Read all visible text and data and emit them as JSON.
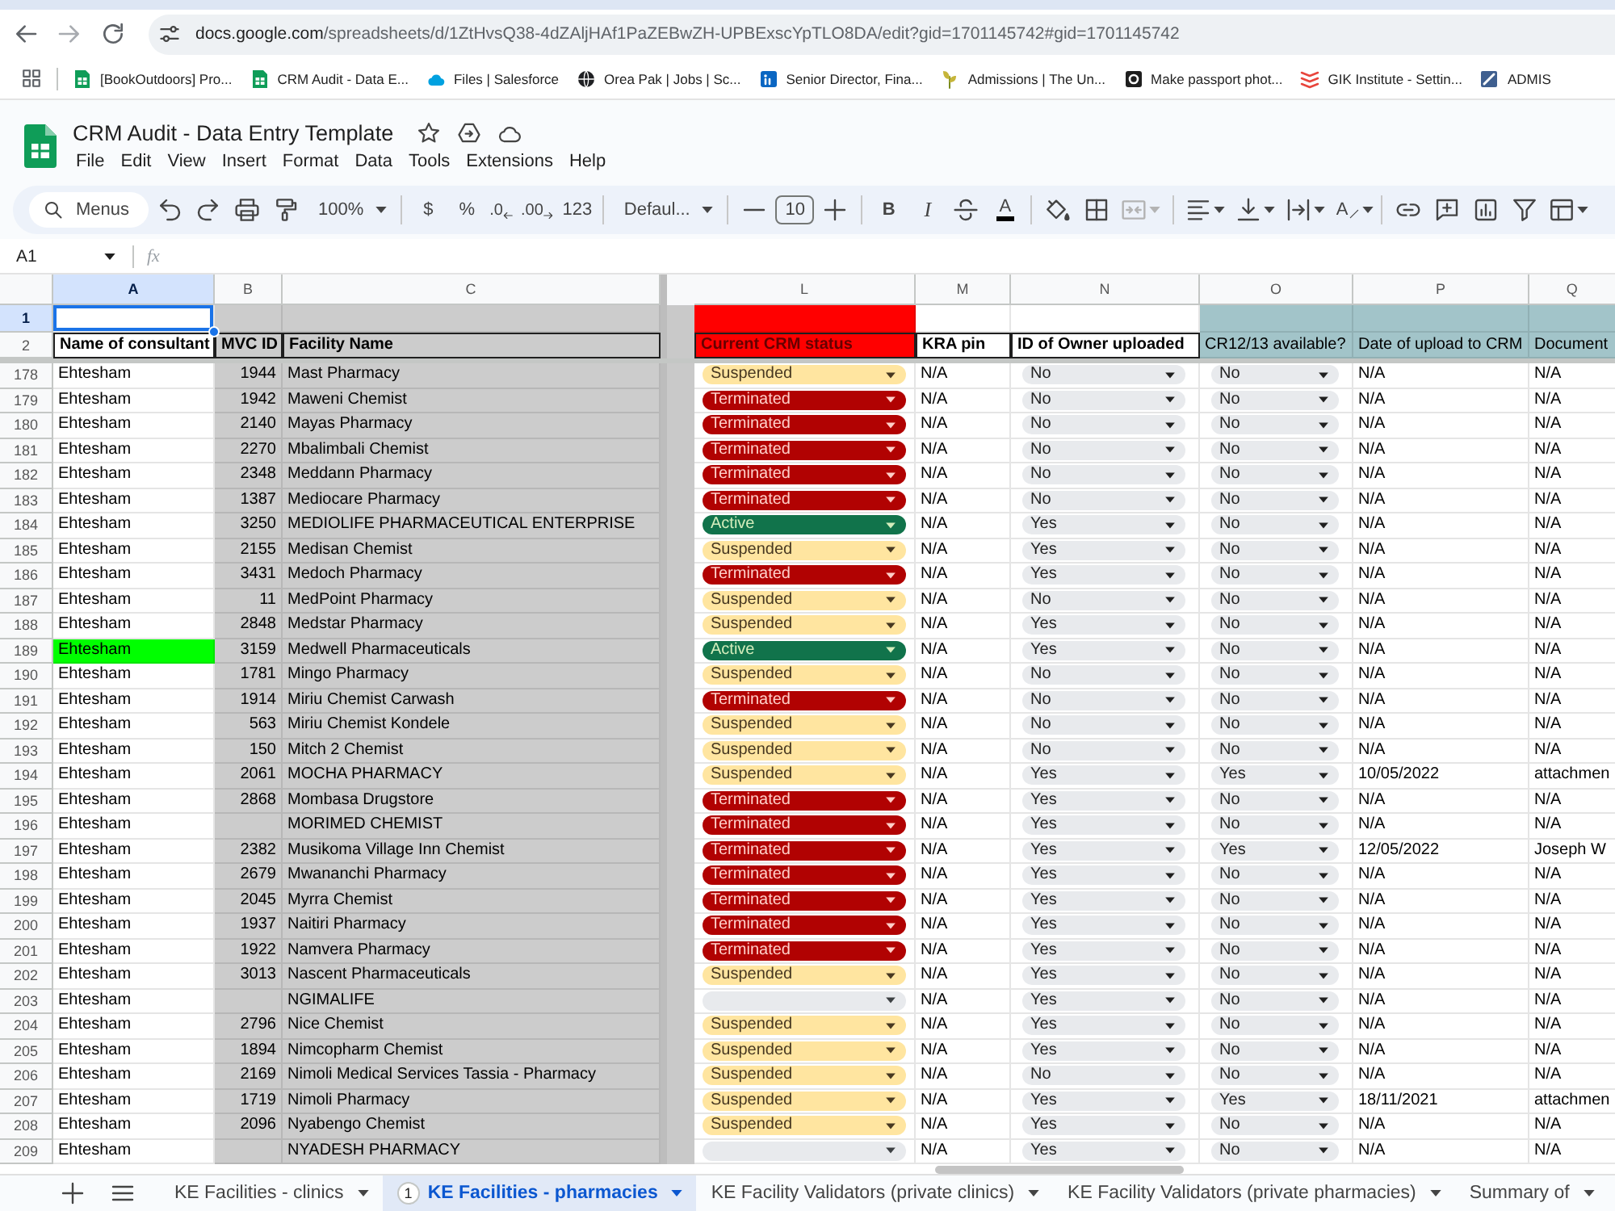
{
  "browser": {
    "address": {
      "host": "docs.google.com",
      "path": "/spreadsheets/d/1ZtHvsQ38-4dZAljHAf1PaZEBwZH-UPBExscYpTLO8DA/edit?gid=1701145742#gid=1701145742"
    },
    "bookmarks": [
      {
        "label": "[BookOutdoors] Pro...",
        "kind": "sheet"
      },
      {
        "label": "CRM Audit - Data E...",
        "kind": "sheet"
      },
      {
        "label": "Files | Salesforce",
        "kind": "cloud"
      },
      {
        "label": "Orea Pak | Jobs | Sc...",
        "kind": "globe"
      },
      {
        "label": "Senior Director, Fina...",
        "kind": "tile"
      },
      {
        "label": "Admissions | The Un...",
        "kind": "plant"
      },
      {
        "label": "Make passport phot...",
        "kind": "ring"
      },
      {
        "label": "GIK Institute - Settin...",
        "kind": "chevrons"
      },
      {
        "label": "ADMIS",
        "kind": "stripe"
      }
    ]
  },
  "document": {
    "title": "CRM Audit - Data Entry Template",
    "menus": [
      "File",
      "Edit",
      "View",
      "Insert",
      "Format",
      "Data",
      "Tools",
      "Extensions",
      "Help"
    ]
  },
  "toolbar": [
    [
      {
        "kind": "search",
        "label": "Menus",
        "disabled": false
      },
      {
        "kind": "undo",
        "disabled": false
      },
      {
        "kind": "redo",
        "disabled": false
      },
      {
        "kind": "print",
        "disabled": false
      },
      {
        "kind": "paint-format",
        "disabled": false
      },
      {
        "kind": "zoom",
        "label": "100%",
        "disabled": false
      }
    ],
    [
      {
        "kind": "currency",
        "label": "$",
        "disabled": false
      },
      {
        "kind": "percent",
        "label": "%",
        "disabled": false
      },
      {
        "kind": "decimal-decrease",
        "label": ".0",
        "disabled": false
      },
      {
        "kind": "decimal-increase",
        "label": ".00",
        "disabled": false
      },
      {
        "kind": "number-format",
        "label": "123",
        "disabled": false
      }
    ],
    [
      {
        "kind": "font",
        "label": "Defaul...",
        "disabled": false
      }
    ],
    [
      {
        "kind": "decrease",
        "disabled": false
      },
      {
        "kind": "font-size",
        "value": "10",
        "disabled": false
      },
      {
        "kind": "increase",
        "disabled": false
      }
    ],
    [
      {
        "kind": "bold",
        "label": "B",
        "disabled": false
      },
      {
        "kind": "italic",
        "label": "I",
        "disabled": false
      },
      {
        "kind": "strikethrough",
        "disabled": false
      },
      {
        "kind": "text-color",
        "label": "A",
        "disabled": false
      }
    ],
    [
      {
        "kind": "fill-color",
        "disabled": false
      },
      {
        "kind": "borders",
        "disabled": false
      },
      {
        "kind": "merge",
        "disabled": true
      }
    ],
    [
      {
        "kind": "align",
        "disabled": false
      },
      {
        "kind": "valign",
        "disabled": false
      },
      {
        "kind": "wrap",
        "disabled": false
      },
      {
        "kind": "rotate",
        "label": "A",
        "disabled": false
      }
    ],
    [
      {
        "kind": "link",
        "disabled": false
      },
      {
        "kind": "comment",
        "disabled": false
      },
      {
        "kind": "chart",
        "disabled": false
      },
      {
        "kind": "filter",
        "disabled": false
      },
      {
        "kind": "table",
        "disabled": false
      }
    ]
  ],
  "formula_bar": {
    "name_box": "A1",
    "function_label": "fx"
  },
  "sheet": {
    "columns": [
      {
        "label": "A",
        "selected": true,
        "freeze_after": false
      },
      {
        "label": "B",
        "selected": false,
        "color": "#cccccc",
        "freeze_after": false
      },
      {
        "label": "C",
        "selected": false,
        "color": "#cccccc",
        "freeze_after": true
      },
      {
        "label": "L",
        "selected": false,
        "freeze_after": false
      },
      {
        "label": "M",
        "selected": false,
        "freeze_after": false
      },
      {
        "label": "N",
        "selected": false,
        "freeze_after": false
      },
      {
        "label": "O",
        "selected": false,
        "freeze_after": false
      },
      {
        "label": "P",
        "selected": false,
        "freeze_after": false
      },
      {
        "label": "Q",
        "selected": false,
        "freeze_after": false
      }
    ],
    "header_rows": [
      {
        "row": "1",
        "selected": true,
        "cells": [
          {
            "color": "#ffffff",
            "selected": true
          },
          {
            "color": "#cccccc",
            "selected": false
          },
          {
            "color": "#cccccc",
            "selected": false
          },
          {
            "color": "#ff0000",
            "selected": false
          },
          {
            "color": "#ffffff",
            "selected": false
          },
          {
            "color": "#ffffff",
            "selected": false
          },
          {
            "color": "#a2c4c9",
            "selected": false
          },
          {
            "color": "#a2c4c9",
            "selected": false
          },
          {
            "color": "#a2c4c9",
            "selected": false
          }
        ]
      },
      {
        "row": "2",
        "selected": false,
        "cells": [
          {
            "text": "Name of consultant",
            "color": "#ffffff",
            "bold": true,
            "bordered": true,
            "selected": false
          },
          {
            "text": "MVC ID",
            "color": "#cccccc",
            "bold": true,
            "bordered": true,
            "selected": false
          },
          {
            "text": "Facility Name",
            "color": "#cccccc",
            "bold": true,
            "bordered": true,
            "selected": false
          },
          {
            "text": "Current CRM status",
            "color": "#ff0000",
            "text_style": {
              "color": "#660000"
            },
            "bold": true,
            "bordered": true,
            "selected": false
          },
          {
            "text": "KRA pin",
            "color": "#ffffff",
            "bold": true,
            "bordered": true,
            "selected": false
          },
          {
            "text": "ID of Owner uploaded",
            "color": "#ffffff",
            "bold": true,
            "bordered": true,
            "selected": false
          },
          {
            "text": "CR12/13 available?",
            "color": "#a2c4c9",
            "bold": false,
            "bordered": false,
            "selected": false
          },
          {
            "text": "Date of upload to CRM",
            "color": "#a2c4c9",
            "bold": false,
            "bordered": false,
            "selected": false
          },
          {
            "text": "Document",
            "color": "#a2c4c9",
            "bold": false,
            "bordered": false,
            "selected": false
          }
        ]
      }
    ],
    "rows": [
      {
        "row": "178",
        "consultant": "Ehtesham",
        "highlighted": false,
        "mvc_id": "1944",
        "facility": "Mast Pharmacy",
        "crm_status": {
          "kind": "suspended",
          "label": "Suspended"
        },
        "kra_pin": "N/A",
        "owner_id_uploaded": "No",
        "cr12_13_available": "No",
        "upload_date": "N/A",
        "document": "N/A"
      },
      {
        "row": "179",
        "consultant": "Ehtesham",
        "highlighted": false,
        "mvc_id": "1942",
        "facility": "Maweni Chemist",
        "crm_status": {
          "kind": "terminated",
          "label": "Terminated"
        },
        "kra_pin": "N/A",
        "owner_id_uploaded": "No",
        "cr12_13_available": "No",
        "upload_date": "N/A",
        "document": "N/A"
      },
      {
        "row": "180",
        "consultant": "Ehtesham",
        "highlighted": false,
        "mvc_id": "2140",
        "facility": "Mayas Pharmacy",
        "crm_status": {
          "kind": "terminated",
          "label": "Terminated"
        },
        "kra_pin": "N/A",
        "owner_id_uploaded": "No",
        "cr12_13_available": "No",
        "upload_date": "N/A",
        "document": "N/A"
      },
      {
        "row": "181",
        "consultant": "Ehtesham",
        "highlighted": false,
        "mvc_id": "2270",
        "facility": "Mbalimbali Chemist",
        "crm_status": {
          "kind": "terminated",
          "label": "Terminated"
        },
        "kra_pin": "N/A",
        "owner_id_uploaded": "No",
        "cr12_13_available": "No",
        "upload_date": "N/A",
        "document": "N/A"
      },
      {
        "row": "182",
        "consultant": "Ehtesham",
        "highlighted": false,
        "mvc_id": "2348",
        "facility": "Meddann Pharmacy",
        "crm_status": {
          "kind": "terminated",
          "label": "Terminated"
        },
        "kra_pin": "N/A",
        "owner_id_uploaded": "No",
        "cr12_13_available": "No",
        "upload_date": "N/A",
        "document": "N/A"
      },
      {
        "row": "183",
        "consultant": "Ehtesham",
        "highlighted": false,
        "mvc_id": "1387",
        "facility": "Mediocare Pharmacy",
        "crm_status": {
          "kind": "terminated",
          "label": "Terminated"
        },
        "kra_pin": "N/A",
        "owner_id_uploaded": "No",
        "cr12_13_available": "No",
        "upload_date": "N/A",
        "document": "N/A"
      },
      {
        "row": "184",
        "consultant": "Ehtesham",
        "highlighted": false,
        "mvc_id": "3250",
        "facility": "MEDIOLIFE PHARMACEUTICAL ENTERPRISE",
        "crm_status": {
          "kind": "active",
          "label": "Active"
        },
        "kra_pin": "N/A",
        "owner_id_uploaded": "Yes",
        "cr12_13_available": "No",
        "upload_date": "N/A",
        "document": "N/A"
      },
      {
        "row": "185",
        "consultant": "Ehtesham",
        "highlighted": false,
        "mvc_id": "2155",
        "facility": "Medisan Chemist",
        "crm_status": {
          "kind": "suspended",
          "label": "Suspended"
        },
        "kra_pin": "N/A",
        "owner_id_uploaded": "Yes",
        "cr12_13_available": "No",
        "upload_date": "N/A",
        "document": "N/A"
      },
      {
        "row": "186",
        "consultant": "Ehtesham",
        "highlighted": false,
        "mvc_id": "3431",
        "facility": "Medoch Pharmacy",
        "crm_status": {
          "kind": "terminated",
          "label": "Terminated"
        },
        "kra_pin": "N/A",
        "owner_id_uploaded": "Yes",
        "cr12_13_available": "No",
        "upload_date": "N/A",
        "document": "N/A"
      },
      {
        "row": "187",
        "consultant": "Ehtesham",
        "highlighted": false,
        "mvc_id": "11",
        "facility": "MedPoint Pharmacy",
        "crm_status": {
          "kind": "suspended",
          "label": "Suspended"
        },
        "kra_pin": "N/A",
        "owner_id_uploaded": "No",
        "cr12_13_available": "No",
        "upload_date": "N/A",
        "document": "N/A"
      },
      {
        "row": "188",
        "consultant": "Ehtesham",
        "highlighted": false,
        "mvc_id": "2848",
        "facility": "Medstar Pharmacy",
        "crm_status": {
          "kind": "suspended",
          "label": "Suspended"
        },
        "kra_pin": "N/A",
        "owner_id_uploaded": "Yes",
        "cr12_13_available": "No",
        "upload_date": "N/A",
        "document": "N/A"
      },
      {
        "row": "189",
        "consultant": "Ehtesham",
        "highlighted": true,
        "mvc_id": "3159",
        "facility": "Medwell Pharmaceuticals",
        "crm_status": {
          "kind": "active",
          "label": "Active"
        },
        "kra_pin": "N/A",
        "owner_id_uploaded": "Yes",
        "cr12_13_available": "No",
        "upload_date": "N/A",
        "document": "N/A"
      },
      {
        "row": "190",
        "consultant": "Ehtesham",
        "highlighted": false,
        "mvc_id": "1781",
        "facility": "Mingo Pharmacy",
        "crm_status": {
          "kind": "suspended",
          "label": "Suspended"
        },
        "kra_pin": "N/A",
        "owner_id_uploaded": "No",
        "cr12_13_available": "No",
        "upload_date": "N/A",
        "document": "N/A"
      },
      {
        "row": "191",
        "consultant": "Ehtesham",
        "highlighted": false,
        "mvc_id": "1914",
        "facility": "Miriu Chemist Carwash",
        "crm_status": {
          "kind": "terminated",
          "label": "Terminated"
        },
        "kra_pin": "N/A",
        "owner_id_uploaded": "No",
        "cr12_13_available": "No",
        "upload_date": "N/A",
        "document": "N/A"
      },
      {
        "row": "192",
        "consultant": "Ehtesham",
        "highlighted": false,
        "mvc_id": "563",
        "facility": "Miriu Chemist Kondele",
        "crm_status": {
          "kind": "suspended",
          "label": "Suspended"
        },
        "kra_pin": "N/A",
        "owner_id_uploaded": "No",
        "cr12_13_available": "No",
        "upload_date": "N/A",
        "document": "N/A"
      },
      {
        "row": "193",
        "consultant": "Ehtesham",
        "highlighted": false,
        "mvc_id": "150",
        "facility": "Mitch 2 Chemist",
        "crm_status": {
          "kind": "suspended",
          "label": "Suspended"
        },
        "kra_pin": "N/A",
        "owner_id_uploaded": "No",
        "cr12_13_available": "No",
        "upload_date": "N/A",
        "document": "N/A"
      },
      {
        "row": "194",
        "consultant": "Ehtesham",
        "highlighted": false,
        "mvc_id": "2061",
        "facility": "MOCHA PHARMACY",
        "crm_status": {
          "kind": "suspended",
          "label": "Suspended"
        },
        "kra_pin": "N/A",
        "owner_id_uploaded": "Yes",
        "cr12_13_available": "Yes",
        "upload_date": "10/05/2022",
        "document": "attachmen"
      },
      {
        "row": "195",
        "consultant": "Ehtesham",
        "highlighted": false,
        "mvc_id": "2868",
        "facility": "Mombasa Drugstore",
        "crm_status": {
          "kind": "terminated",
          "label": "Terminated"
        },
        "kra_pin": "N/A",
        "owner_id_uploaded": "Yes",
        "cr12_13_available": "No",
        "upload_date": "N/A",
        "document": "N/A"
      },
      {
        "row": "196",
        "consultant": "Ehtesham",
        "highlighted": false,
        "facility": "MORIMED CHEMIST",
        "crm_status": {
          "kind": "terminated",
          "label": "Terminated"
        },
        "kra_pin": "N/A",
        "owner_id_uploaded": "Yes",
        "cr12_13_available": "No",
        "upload_date": "N/A",
        "document": "N/A"
      },
      {
        "row": "197",
        "consultant": "Ehtesham",
        "highlighted": false,
        "mvc_id": "2382",
        "facility": "Musikoma Village Inn Chemist",
        "crm_status": {
          "kind": "terminated",
          "label": "Terminated"
        },
        "kra_pin": "N/A",
        "owner_id_uploaded": "Yes",
        "cr12_13_available": "Yes",
        "upload_date": "12/05/2022",
        "document": "Joseph W"
      },
      {
        "row": "198",
        "consultant": "Ehtesham",
        "highlighted": false,
        "mvc_id": "2679",
        "facility": "Mwananchi Pharmacy",
        "crm_status": {
          "kind": "terminated",
          "label": "Terminated"
        },
        "kra_pin": "N/A",
        "owner_id_uploaded": "Yes",
        "cr12_13_available": "No",
        "upload_date": "N/A",
        "document": "N/A"
      },
      {
        "row": "199",
        "consultant": "Ehtesham",
        "highlighted": false,
        "mvc_id": "2045",
        "facility": "Myrra Chemist",
        "crm_status": {
          "kind": "terminated",
          "label": "Terminated"
        },
        "kra_pin": "N/A",
        "owner_id_uploaded": "Yes",
        "cr12_13_available": "No",
        "upload_date": "N/A",
        "document": "N/A"
      },
      {
        "row": "200",
        "consultant": "Ehtesham",
        "highlighted": false,
        "mvc_id": "1937",
        "facility": "Naitiri Pharmacy",
        "crm_status": {
          "kind": "terminated",
          "label": "Terminated"
        },
        "kra_pin": "N/A",
        "owner_id_uploaded": "Yes",
        "cr12_13_available": "No",
        "upload_date": "N/A",
        "document": "N/A"
      },
      {
        "row": "201",
        "consultant": "Ehtesham",
        "highlighted": false,
        "mvc_id": "1922",
        "facility": "Namvera Pharmacy",
        "crm_status": {
          "kind": "terminated",
          "label": "Terminated"
        },
        "kra_pin": "N/A",
        "owner_id_uploaded": "Yes",
        "cr12_13_available": "No",
        "upload_date": "N/A",
        "document": "N/A"
      },
      {
        "row": "202",
        "consultant": "Ehtesham",
        "highlighted": false,
        "mvc_id": "3013",
        "facility": "Nascent Pharmaceuticals",
        "crm_status": {
          "kind": "suspended",
          "label": "Suspended"
        },
        "kra_pin": "N/A",
        "owner_id_uploaded": "Yes",
        "cr12_13_available": "No",
        "upload_date": "N/A",
        "document": "N/A"
      },
      {
        "row": "203",
        "consultant": "Ehtesham",
        "highlighted": false,
        "facility": "NGIMALIFE",
        "crm_status": {
          "kind": "empty"
        },
        "kra_pin": "N/A",
        "owner_id_uploaded": "Yes",
        "cr12_13_available": "No",
        "upload_date": "N/A",
        "document": "N/A"
      },
      {
        "row": "204",
        "consultant": "Ehtesham",
        "highlighted": false,
        "mvc_id": "2796",
        "facility": "Nice Chemist",
        "crm_status": {
          "kind": "suspended",
          "label": "Suspended"
        },
        "kra_pin": "N/A",
        "owner_id_uploaded": "Yes",
        "cr12_13_available": "No",
        "upload_date": "N/A",
        "document": "N/A"
      },
      {
        "row": "205",
        "consultant": "Ehtesham",
        "highlighted": false,
        "mvc_id": "1894",
        "facility": "Nimcopharm Chemist",
        "crm_status": {
          "kind": "suspended",
          "label": "Suspended"
        },
        "kra_pin": "N/A",
        "owner_id_uploaded": "Yes",
        "cr12_13_available": "No",
        "upload_date": "N/A",
        "document": "N/A"
      },
      {
        "row": "206",
        "consultant": "Ehtesham",
        "highlighted": false,
        "mvc_id": "2169",
        "facility": "Nimoli Medical Services Tassia - Pharmacy",
        "crm_status": {
          "kind": "suspended",
          "label": "Suspended"
        },
        "kra_pin": "N/A",
        "owner_id_uploaded": "No",
        "cr12_13_available": "No",
        "upload_date": "N/A",
        "document": "N/A"
      },
      {
        "row": "207",
        "consultant": "Ehtesham",
        "highlighted": false,
        "mvc_id": "1719",
        "facility": "Nimoli Pharmacy",
        "crm_status": {
          "kind": "suspended",
          "label": "Suspended"
        },
        "kra_pin": "N/A",
        "owner_id_uploaded": "Yes",
        "cr12_13_available": "Yes",
        "upload_date": "18/11/2021",
        "document": "attachmen"
      },
      {
        "row": "208",
        "consultant": "Ehtesham",
        "highlighted": false,
        "mvc_id": "2096",
        "facility": "Nyabengo Chemist",
        "crm_status": {
          "kind": "suspended",
          "label": "Suspended"
        },
        "kra_pin": "N/A",
        "owner_id_uploaded": "Yes",
        "cr12_13_available": "No",
        "upload_date": "N/A",
        "document": "N/A"
      },
      {
        "row": "209",
        "consultant": "Ehtesham",
        "highlighted": false,
        "facility": "NYADESH PHARMACY",
        "crm_status": {
          "kind": "empty"
        },
        "kra_pin": "N/A",
        "owner_id_uploaded": "Yes",
        "cr12_13_available": "No",
        "upload_date": "N/A",
        "document": "N/A"
      }
    ]
  },
  "sheet_tabs": [
    {
      "label": "KE Facilities - clinics",
      "selected": false
    },
    {
      "label": "KE Facilities - pharmacies",
      "selected": true,
      "badge": "1"
    },
    {
      "label": "KE Facility Validators (private clinics)",
      "selected": false
    },
    {
      "label": "KE Facility Validators (private pharmacies)",
      "selected": false
    },
    {
      "label": "Summary of",
      "selected": false
    }
  ]
}
